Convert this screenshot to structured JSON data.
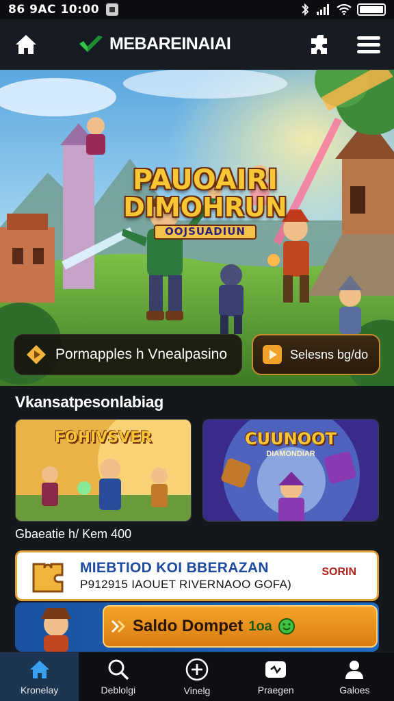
{
  "status_bar": {
    "time": "86 9AC 10:00",
    "icons": [
      "app-square-icon",
      "bluetooth-icon",
      "signal-icon",
      "wifi-icon",
      "battery-icon"
    ]
  },
  "header": {
    "brand": "MEBAREINAIAI",
    "icons": [
      "home-icon",
      "logo-check-icon",
      "puzzle-icon",
      "menu-icon"
    ]
  },
  "hero": {
    "title_line1": "PAUOAIRI",
    "title_line2": "DIMOHRUN",
    "title_line3": "OOJSUADIUN",
    "primary_cta": "Pormapples h Vnealpasino",
    "secondary_cta": "Selesns bg/do"
  },
  "section": {
    "title": "Vkansatpesonlabiag",
    "cards": [
      {
        "title": "FOHIVSVER"
      },
      {
        "title": "CUUNOOT",
        "subtitle": "DIAMONDIAR"
      }
    ],
    "caption": "Gbaeatie h/ Kem 400"
  },
  "banner": {
    "line1": "MIEBTIOD KOI BBERAZAN",
    "line2": "P912915 IAOUET RIVERNAOO GOFA)",
    "tag": "SORIN"
  },
  "saldo": {
    "label": "Saldo Dompet",
    "value": "1oa"
  },
  "bottom_nav": [
    {
      "label": "Kronelay",
      "icon": "home-icon",
      "active": true
    },
    {
      "label": "Deblolgi",
      "icon": "search-icon",
      "active": false
    },
    {
      "label": "Vinelg",
      "icon": "plus-circle-icon",
      "active": false
    },
    {
      "label": "Praegen",
      "icon": "wallet-icon",
      "active": false
    },
    {
      "label": "Galoes",
      "icon": "user-icon",
      "active": false
    }
  ],
  "colors": {
    "accent": "#f6c635",
    "nav_active": "#1c3550",
    "banner_border": "#e0a13a",
    "saldo_pill": "#f4a52a"
  }
}
